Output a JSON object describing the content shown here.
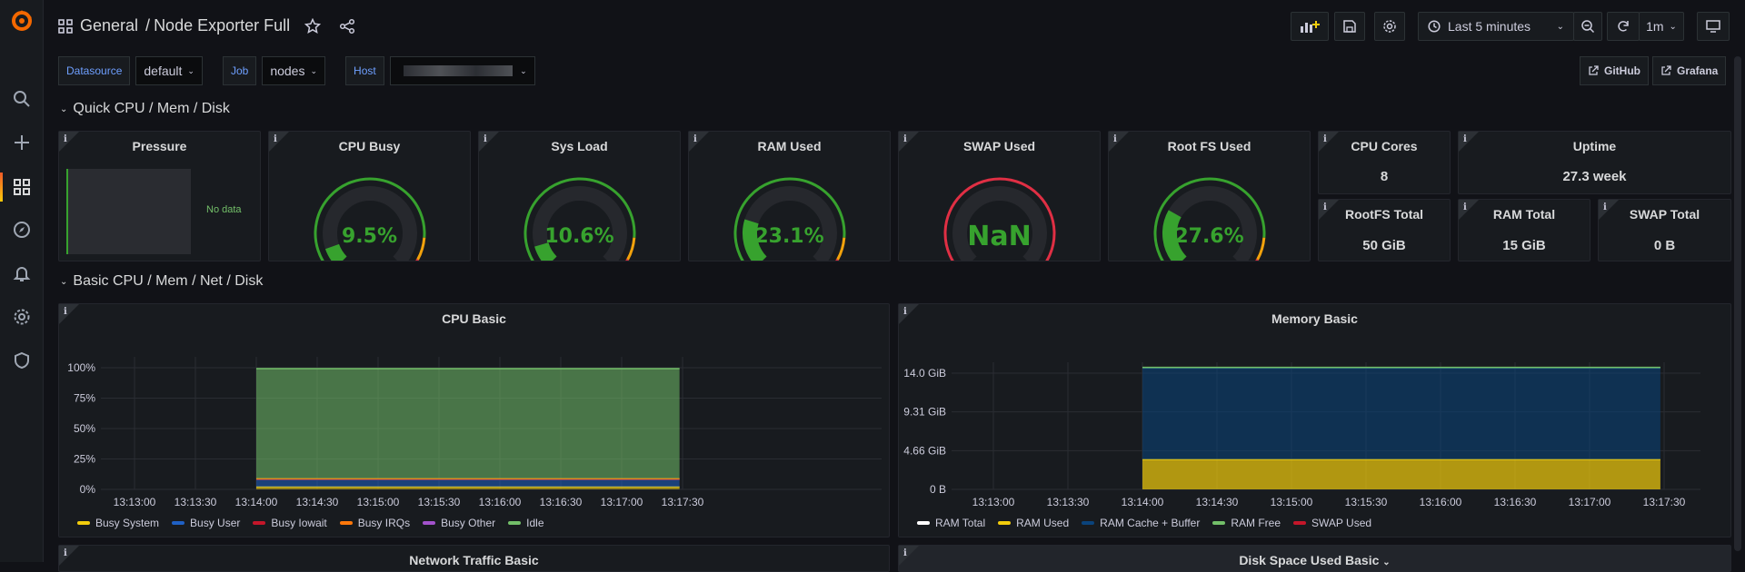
{
  "topbar": {
    "folder": "General",
    "separator": "/",
    "dashboard_title": "Node Exporter Full",
    "time_range": "Last 5 minutes",
    "refresh_interval": "1m"
  },
  "variables": [
    {
      "label": "Datasource",
      "value": "default"
    },
    {
      "label": "Job",
      "value": "nodes"
    },
    {
      "label": "Host",
      "value": ""
    }
  ],
  "links": {
    "github": "GitHub",
    "grafana": "Grafana"
  },
  "rows": {
    "quick": "Quick CPU / Mem / Disk",
    "basic": "Basic CPU / Mem / Net / Disk"
  },
  "pressure": {
    "title": "Pressure",
    "no_data": "No data"
  },
  "gauges": [
    {
      "title": "CPU Busy",
      "value_text": "9.5%",
      "fraction": 0.095
    },
    {
      "title": "Sys Load",
      "value_text": "10.6%",
      "fraction": 0.106
    },
    {
      "title": "RAM Used",
      "value_text": "23.1%",
      "fraction": 0.231
    },
    {
      "title": "SWAP Used",
      "value_text": "NaN",
      "fraction": 0
    },
    {
      "title": "Root FS Used",
      "value_text": "27.6%",
      "fraction": 0.276
    }
  ],
  "stats": {
    "cpu_cores": {
      "title": "CPU Cores",
      "value": "8"
    },
    "uptime": {
      "title": "Uptime",
      "value": "27.3 week"
    },
    "rootfs_total": {
      "title": "RootFS Total",
      "value": "50 GiB"
    },
    "ram_total": {
      "title": "RAM Total",
      "value": "15 GiB"
    },
    "swap_total": {
      "title": "SWAP Total",
      "value": "0 B"
    }
  },
  "colors": {
    "green": "#37a22e",
    "orange": "#f2cc0c",
    "red": "#e02f44",
    "accent": "#6e9fff"
  },
  "chart_data": [
    {
      "type": "area",
      "title": "CPU Basic",
      "x": [
        "13:13:00",
        "13:13:30",
        "13:14:00",
        "13:14:30",
        "13:15:00",
        "13:15:30",
        "13:16:00",
        "13:16:30",
        "13:17:00",
        "13:17:30"
      ],
      "y_ticks": [
        "0%",
        "25%",
        "50%",
        "75%",
        "100%"
      ],
      "ylim": [
        0,
        100
      ],
      "data_range": [
        "13:14:00",
        "13:17:30"
      ],
      "series": [
        {
          "name": "Busy System",
          "color": "#f2cc0c",
          "values": [
            2,
            2,
            2,
            2,
            2,
            2,
            2,
            2
          ]
        },
        {
          "name": "Busy User",
          "color": "#1f60c4",
          "values": [
            6,
            6,
            6,
            6,
            6,
            6,
            6,
            6
          ]
        },
        {
          "name": "Busy Iowait",
          "color": "#c4162a",
          "values": [
            0.5,
            0.5,
            0.5,
            0.5,
            0.5,
            0.5,
            0.5,
            0.5
          ]
        },
        {
          "name": "Busy IRQs",
          "color": "#ff780a",
          "values": [
            0.3,
            0.3,
            0.3,
            0.3,
            0.3,
            0.3,
            0.3,
            0.3
          ]
        },
        {
          "name": "Busy Other",
          "color": "#a352cc",
          "values": [
            0,
            0,
            0,
            0,
            0,
            0,
            0,
            0
          ]
        },
        {
          "name": "Idle",
          "color": "#73bf69",
          "values": [
            90.5,
            90.5,
            90.5,
            90.5,
            90.5,
            90.5,
            90.5,
            90.5
          ]
        }
      ]
    },
    {
      "type": "area",
      "title": "Memory Basic",
      "x": [
        "13:13:00",
        "13:13:30",
        "13:14:00",
        "13:14:30",
        "13:15:00",
        "13:15:30",
        "13:16:00",
        "13:16:30",
        "13:17:00",
        "13:17:30"
      ],
      "y_ticks": [
        "0 B",
        "4.66 GiB",
        "9.31 GiB",
        "14.0 GiB"
      ],
      "ylim": [
        0,
        14.0
      ],
      "data_range": [
        "13:14:00",
        "13:17:30"
      ],
      "series": [
        {
          "name": "RAM Total",
          "color": "#ffffff",
          "values": [
            15,
            15,
            15,
            15,
            15,
            15,
            15,
            15
          ]
        },
        {
          "name": "RAM Used",
          "color": "#f2cc0c",
          "values": [
            3.6,
            3.6,
            3.6,
            3.6,
            3.6,
            3.6,
            3.6,
            3.6
          ]
        },
        {
          "name": "RAM Cache + Buffer",
          "color": "#0a437c",
          "values": [
            11.0,
            11.0,
            11.0,
            11.0,
            11.0,
            11.0,
            11.0,
            11.0
          ]
        },
        {
          "name": "RAM Free",
          "color": "#73bf69",
          "values": [
            0.4,
            0.4,
            0.4,
            0.4,
            0.4,
            0.4,
            0.4,
            0.4
          ]
        },
        {
          "name": "SWAP Used",
          "color": "#c4162a",
          "values": [
            0,
            0,
            0,
            0,
            0,
            0,
            0,
            0
          ]
        }
      ]
    }
  ],
  "bottom_panels": {
    "network": "Network Traffic Basic",
    "disk": "Disk Space Used Basic"
  }
}
